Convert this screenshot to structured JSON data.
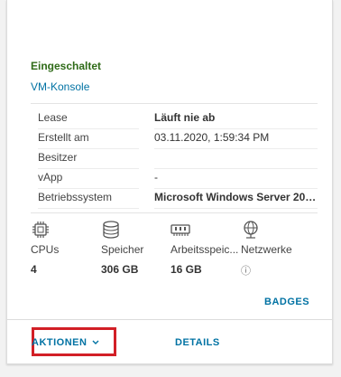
{
  "vm": {
    "status": "Eingeschaltet",
    "console_link": "VM-Konsole"
  },
  "details": [
    {
      "key": "Lease",
      "value": "Läuft nie ab",
      "bold": true
    },
    {
      "key": "Erstellt am",
      "value": "03.11.2020, 1:59:34 PM",
      "bold": false
    },
    {
      "key": "Besitzer",
      "value": "",
      "bold": false
    },
    {
      "key": "vApp",
      "value": "-",
      "bold": false
    },
    {
      "key": "Betriebssystem",
      "value": "Microsoft Windows Server 201...",
      "bold": true
    }
  ],
  "metrics": [
    {
      "icon": "cpu-icon",
      "label": "CPUs",
      "value": "4"
    },
    {
      "icon": "database-icon",
      "label": "Speicher",
      "value": "306 GB"
    },
    {
      "icon": "memory-icon",
      "label": "Arbeitsspeic...",
      "value": "16 GB"
    },
    {
      "icon": "network-icon",
      "label": "Netzwerke",
      "value": "ⓘ"
    }
  ],
  "buttons": {
    "badges": "BADGES",
    "actions": "AKTIONEN",
    "details": "DETAILS"
  },
  "colors": {
    "status_green": "#2f6b18",
    "link_blue": "#0072a3",
    "highlight_red": "#d21f26"
  }
}
